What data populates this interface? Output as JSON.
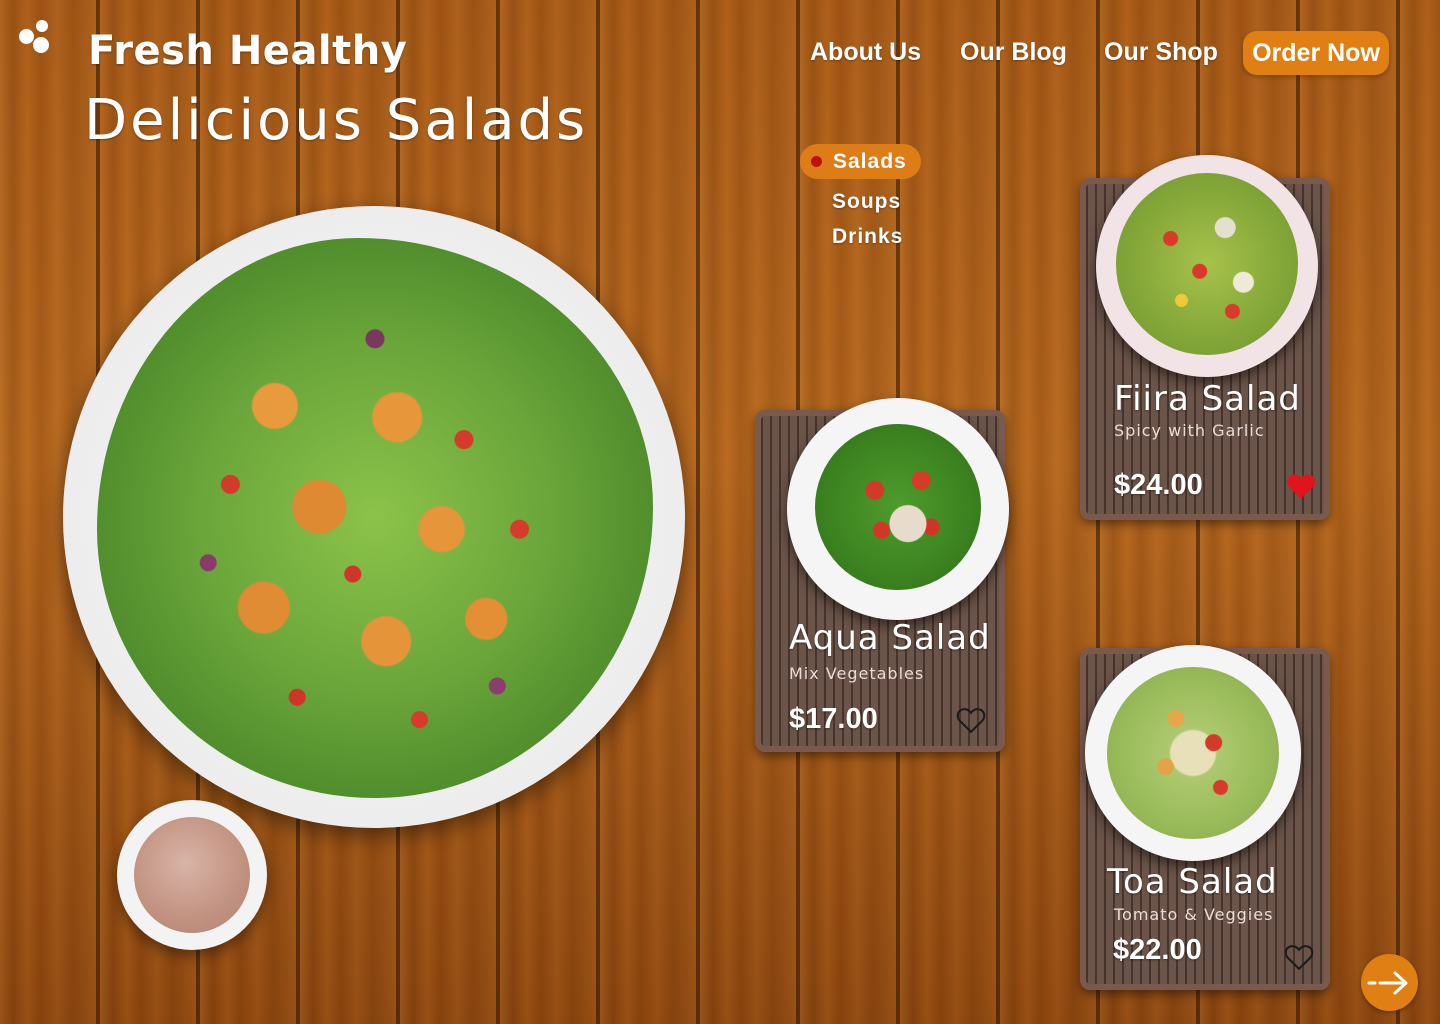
{
  "brand": {
    "logo_icon": "three-dots-logo-icon",
    "name": "Fresh Healthy",
    "headline": "Delicious Salads"
  },
  "nav": {
    "about": "About Us",
    "blog": "Our Blog",
    "shop": "Our Shop",
    "order": "Order Now"
  },
  "categories": {
    "active": "Salads",
    "items": [
      "Salads",
      "Soups",
      "Drinks"
    ]
  },
  "products": [
    {
      "name": "Aqua Salad",
      "desc": "Mix Vegetables",
      "price": "$17.00",
      "favorite": false
    },
    {
      "name": "Fiira Salad",
      "desc": "Spicy with Garlic",
      "price": "$24.00",
      "favorite": true
    },
    {
      "name": "Toa Salad",
      "desc": "Tomato & Veggies",
      "price": "$22.00",
      "favorite": false
    }
  ],
  "next_icon": "arrow-right-icon",
  "colors": {
    "accent": "#e07f14",
    "active_dot": "#c01010",
    "favorite_heart": "#e0141c"
  }
}
